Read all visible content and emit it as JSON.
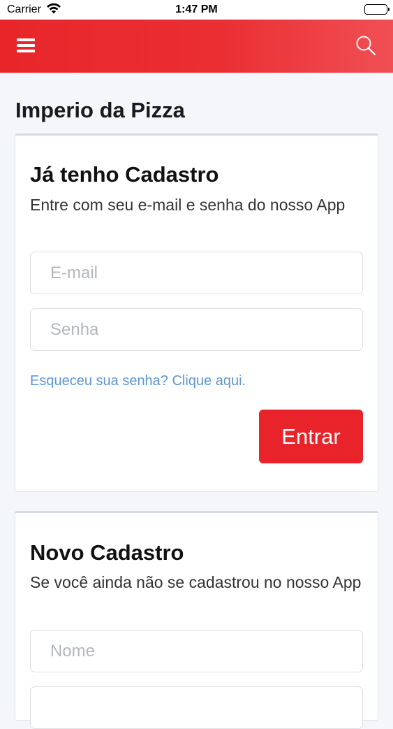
{
  "status_bar": {
    "carrier": "Carrier",
    "time": "1:47 PM",
    "battery_level": 1.0
  },
  "nav": {
    "menu_icon": "hamburger-menu-icon",
    "search_icon": "search-icon",
    "color_start": "#e8262a",
    "color_end": "#f04f54"
  },
  "page": {
    "title": "Imperio da Pizza"
  },
  "login_card": {
    "title": "Já tenho Cadastro",
    "subtitle": "Entre com seu e-mail e senha do nosso App",
    "email_placeholder": "E-mail",
    "password_placeholder": "Senha",
    "forgot_link": "Esqueceu sua senha? Clique aqui.",
    "submit_label": "Entrar"
  },
  "register_card": {
    "title": "Novo Cadastro",
    "subtitle": "Se você ainda não se cadastrou no nosso App",
    "name_placeholder": "Nome"
  },
  "colors": {
    "brand_red": "#e8232a",
    "link_blue": "#5d97d5",
    "background": "#f4f6f9"
  }
}
